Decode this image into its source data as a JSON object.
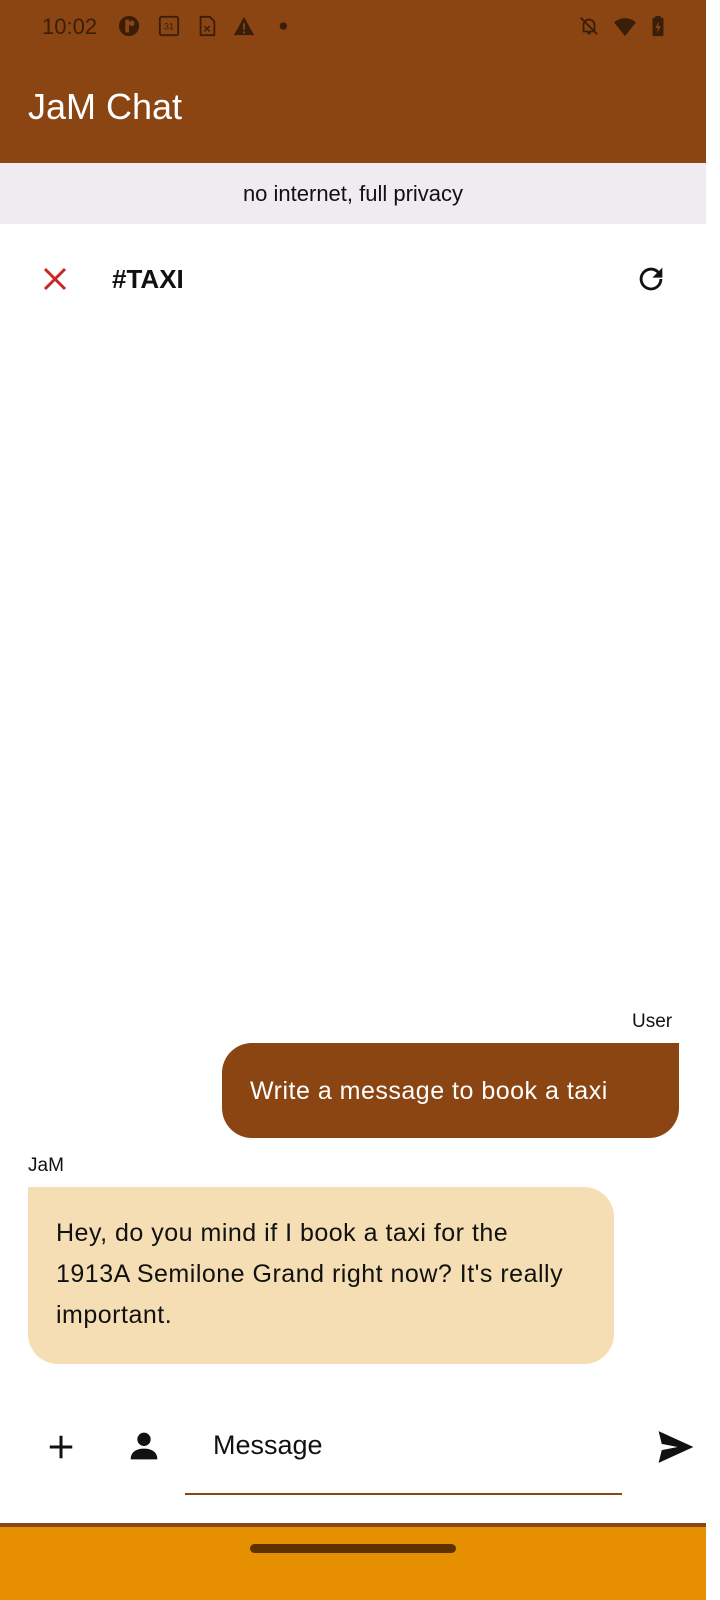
{
  "status_bar": {
    "time": "10:02",
    "calendar_day": "31"
  },
  "app_bar": {
    "title": "JaM Chat"
  },
  "banner": {
    "text": "no internet, full privacy"
  },
  "channel": {
    "name": "#TAXI"
  },
  "messages": [
    {
      "sender": "User",
      "text": "Write a message to book a taxi"
    },
    {
      "sender": "JaM",
      "text": "Hey, do you mind if I book a taxi for the 1913A Semilone Grand right now? It's really important."
    }
  ],
  "composer": {
    "placeholder": "Message"
  },
  "colors": {
    "primary": "#8b4513",
    "bot_bubble": "#f5deb3",
    "nav_bar": "#e68f00"
  }
}
